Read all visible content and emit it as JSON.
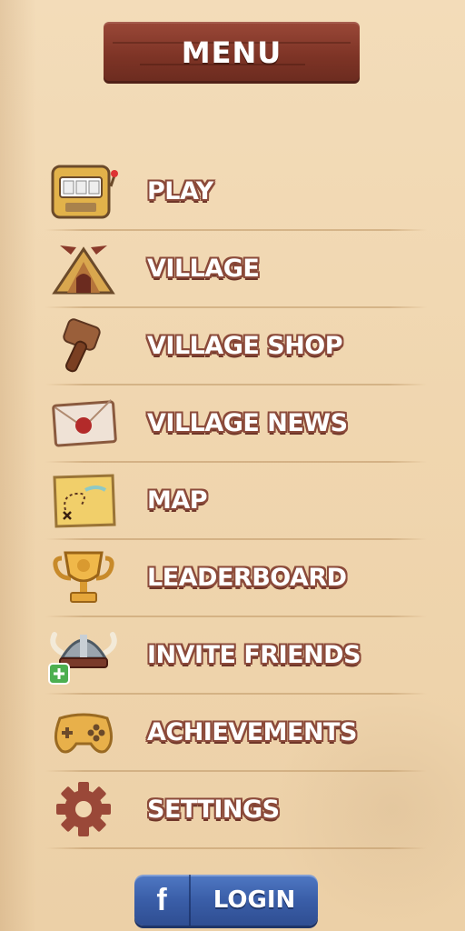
{
  "header": {
    "title": "MENU"
  },
  "menu": {
    "items": [
      {
        "label": "PLAY",
        "icon": "slot-machine-icon"
      },
      {
        "label": "VILLAGE",
        "icon": "viking-hut-icon"
      },
      {
        "label": "VILLAGE SHOP",
        "icon": "hammer-icon"
      },
      {
        "label": "VILLAGE NEWS",
        "icon": "envelope-icon"
      },
      {
        "label": "MAP",
        "icon": "treasure-map-icon"
      },
      {
        "label": "LEADERBOARD",
        "icon": "trophy-icon"
      },
      {
        "label": "INVITE FRIENDS",
        "icon": "viking-helmet-add-icon"
      },
      {
        "label": "ACHIEVEMENTS",
        "icon": "gamepad-icon"
      },
      {
        "label": "SETTINGS",
        "icon": "gear-icon"
      }
    ]
  },
  "login": {
    "label": "LOGIN",
    "icon": "facebook-icon"
  },
  "colors": {
    "background": "#f0d6af",
    "plank": "#7e3426",
    "label_outline": "#8b4a3a",
    "login_button": "#3a5ea8"
  }
}
